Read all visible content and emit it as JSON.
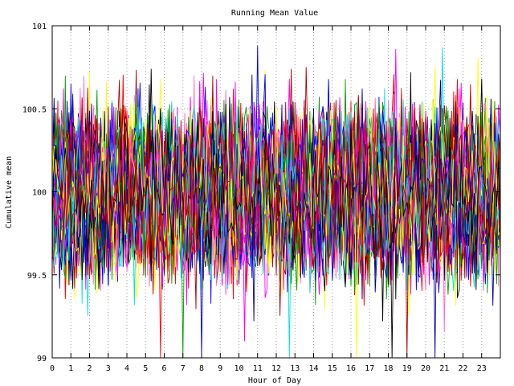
{
  "chart_data": {
    "type": "line",
    "title": "Running Mean Value",
    "xlabel": "Hour of Day",
    "ylabel": "Cumulative mean",
    "xlim": [
      0,
      24
    ],
    "ylim": [
      99,
      101
    ],
    "xticks": [
      0,
      1,
      2,
      3,
      4,
      5,
      6,
      7,
      8,
      9,
      10,
      11,
      12,
      13,
      14,
      15,
      16,
      17,
      18,
      19,
      20,
      21,
      22,
      23
    ],
    "yticks": [
      99,
      99.5,
      100,
      100.5,
      101
    ],
    "grid": true,
    "grid_style": "dotted",
    "legend": "none",
    "series_count": 48,
    "samples_per_series": 240,
    "series_colors": [
      "#ff0000",
      "#00a000",
      "#0000ff",
      "#ff00ff",
      "#00e0e0",
      "#ffff00",
      "#000000",
      "#b00000",
      "#0000a0",
      "#ff6ec7"
    ],
    "value_center": 100,
    "typical_band": [
      99.6,
      100.4
    ],
    "observed_max": 100.88,
    "observed_min_excursions": [
      {
        "x": 5.8,
        "y": 99
      },
      {
        "x": 7.0,
        "y": 99
      },
      {
        "x": 8.0,
        "y": 99
      },
      {
        "x": 10.3,
        "y": 99.1
      },
      {
        "x": 12.7,
        "y": 99
      },
      {
        "x": 16.3,
        "y": 99
      },
      {
        "x": 18.2,
        "y": 99
      },
      {
        "x": 19.0,
        "y": 99
      },
      {
        "x": 20.5,
        "y": 99
      },
      {
        "x": 21.0,
        "y": 99.16
      }
    ],
    "observed_peaks": [
      {
        "x": 11.0,
        "y": 100.88
      },
      {
        "x": 18.4,
        "y": 100.86
      },
      {
        "x": 20.9,
        "y": 100.87
      },
      {
        "x": 22.8,
        "y": 100.81
      },
      {
        "x": 5.3,
        "y": 100.74
      },
      {
        "x": 12.8,
        "y": 100.74
      }
    ]
  }
}
